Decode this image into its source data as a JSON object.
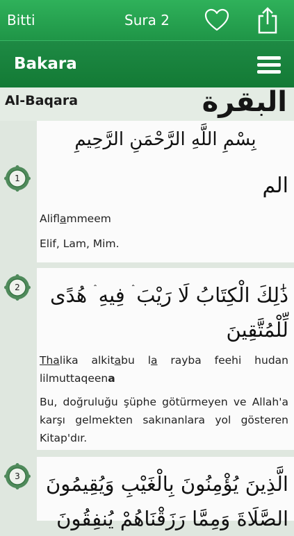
{
  "nav": {
    "done_label": "Bitti",
    "title": "Sura 2"
  },
  "header": {
    "title": "Bakara"
  },
  "sura": {
    "latin_name": "Al-Baqara",
    "arabic_name": "البقرة"
  },
  "bismillah": "بِسْمِ اللَّهِ الرَّحْمَنِ الرَّحِيمِ",
  "verses": [
    {
      "number": "1",
      "arabic": "الم",
      "translit_parts": [
        "Alifl",
        "a",
        "mmeem"
      ],
      "translation": "Elif, Lam, Mim."
    },
    {
      "number": "2",
      "arabic": "ذَٰلِكَ الْكِتَابُ لَا رَيْبَ ۛ فِيهِ ۛ هُدًى لِّلْمُتَّقِينَ",
      "translit_parts": [
        "Th",
        "a",
        "lika alkit",
        "a",
        "bu l",
        "a",
        " rayba feehi hudan lilmuttaqeen",
        "a"
      ],
      "translation": "Bu, doğruluğu şüphe götürmeyen ve Allah'a karşı gelmekten sakınanlara yol gösteren Kitap'dır."
    },
    {
      "number": "3",
      "arabic": "الَّذِينَ يُؤْمِنُونَ بِالْغَيْبِ وَيُقِيمُونَ الصَّلَاةَ وَمِمَّا رَزَقْنَاهُمْ يُنفِقُونَ"
    }
  ],
  "colors": {
    "accent": "#1f9547",
    "badge": "#4f8a5b"
  },
  "icons": {
    "favorite": "heart-icon",
    "share": "share-icon",
    "menu": "menu-icon"
  }
}
